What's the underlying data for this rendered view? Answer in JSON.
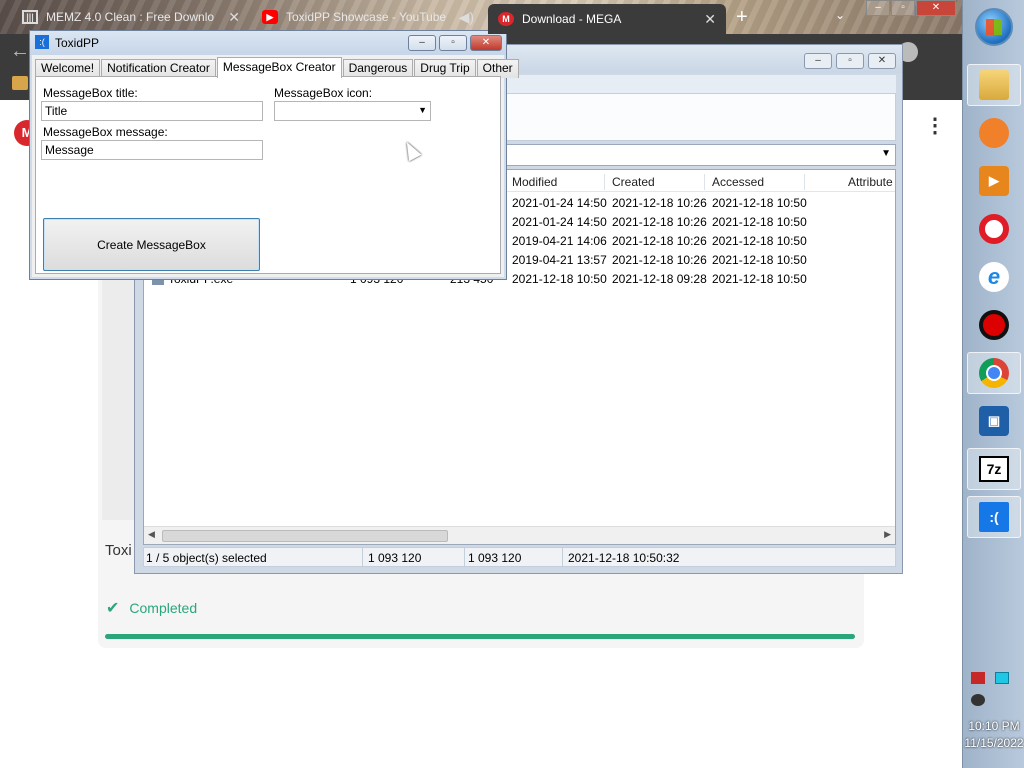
{
  "browser": {
    "tabs": [
      {
        "title": "MEMZ 4.0 Clean : Free Downlo",
        "icon": "memz-favicon"
      },
      {
        "title": "ToxidPP Showcase - YouTube",
        "icon": "youtube-favicon"
      },
      {
        "title": "Download - MEGA",
        "icon": "mega-favicon",
        "active": true
      }
    ]
  },
  "mega_page": {
    "logo_letter": "M",
    "file_label": "Toxi",
    "completed_label": "Completed",
    "download_progress": 1.0,
    "accent_color": "#2ba67a"
  },
  "file_manager": {
    "columns": [
      "Modified",
      "Created",
      "Accessed",
      "Attribute"
    ],
    "rows": [
      {
        "modified": "2021-01-24 14:50",
        "created": "2021-12-18 10:26",
        "accessed": "2021-12-18 10:50"
      },
      {
        "modified": "2021-01-24 14:50",
        "created": "2021-12-18 10:26",
        "accessed": "2021-12-18 10:50"
      },
      {
        "modified": "2019-04-21 14:06",
        "created": "2021-12-18 10:26",
        "accessed": "2021-12-18 10:50"
      },
      {
        "modified": "2019-04-21 13:57",
        "created": "2021-12-18 10:26",
        "accessed": "2021-12-18 10:50"
      },
      {
        "name": "ToxidPP.exe",
        "size": "1 093 120",
        "packed": "213 450",
        "modified": "2021-12-18 10:50",
        "created": "2021-12-18 09:28",
        "accessed": "2021-12-18 10:50"
      }
    ],
    "status": {
      "selection": "1 / 5 object(s) selected",
      "size": "1 093 120",
      "packed": "1 093 120",
      "date": "2021-12-18 10:50:32"
    }
  },
  "toxidpp": {
    "title": "ToxidPP",
    "tabs": [
      "Welcome!",
      "Notification Creator",
      "MessageBox Creator",
      "Dangerous",
      "Drug Trip",
      "Other"
    ],
    "active_tab": "MessageBox Creator",
    "form": {
      "title_label": "MessageBox title:",
      "title_value": "Title",
      "message_label": "MessageBox message:",
      "message_value": "Message",
      "icon_label": "MessageBox icon:",
      "icon_value": "",
      "create_button": "Create MessageBox"
    }
  },
  "taskbar": {
    "items": [
      "explorer-icon",
      "uc-browser-icon",
      "media-player-icon",
      "opera-icon",
      "internet-explorer-icon",
      "recorder-icon",
      "chrome-icon",
      "virtualbox-icon",
      "7zip-icon",
      "toxidpp-icon"
    ],
    "sevenzip_text": "7z",
    "toxidpp_text": ":(",
    "time": "10:10 PM",
    "date": "11/15/2022"
  }
}
